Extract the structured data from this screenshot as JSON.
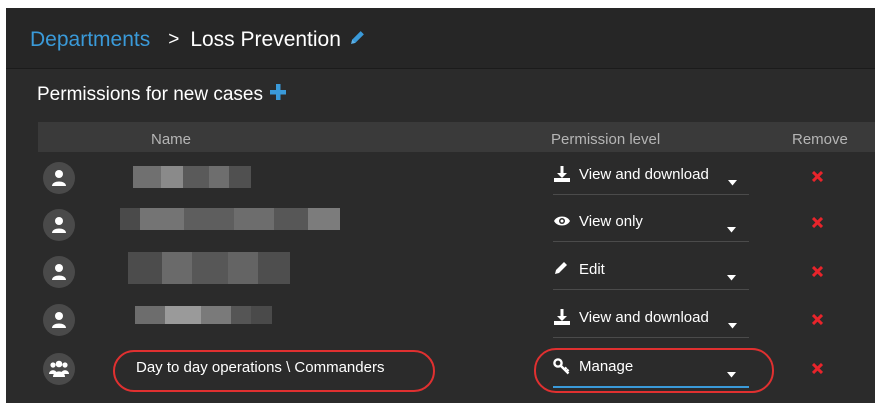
{
  "breadcrumb": {
    "parent": "Departments",
    "separator": ">",
    "current": "Loss Prevention",
    "edit_icon": "pencil-icon"
  },
  "section": {
    "title": "Permissions for new cases",
    "add_icon": "plus-icon"
  },
  "table": {
    "columns": {
      "name": "Name",
      "permission": "Permission level",
      "remove": "Remove"
    },
    "rows": [
      {
        "type": "user",
        "avatar_icon": "user-icon",
        "name": "",
        "permission": "View and download",
        "permission_icon": "download-icon",
        "remove_icon": "close-icon"
      },
      {
        "type": "user",
        "avatar_icon": "user-icon",
        "name": "",
        "permission": "View only",
        "permission_icon": "eye-icon",
        "remove_icon": "close-icon"
      },
      {
        "type": "user",
        "avatar_icon": "user-icon",
        "name": "",
        "permission": "Edit",
        "permission_icon": "pencil-icon",
        "remove_icon": "close-icon"
      },
      {
        "type": "user",
        "avatar_icon": "user-icon",
        "name": "",
        "permission": "View and download",
        "permission_icon": "download-icon",
        "remove_icon": "close-icon"
      },
      {
        "type": "group",
        "avatar_icon": "group-icon",
        "name": "Day to day operations \\ Commanders",
        "permission": "Manage",
        "permission_icon": "key-icon",
        "remove_icon": "close-icon"
      }
    ]
  },
  "colors": {
    "accent": "#3a9ad9",
    "remove": "#e8242b",
    "annotation": "#e03030",
    "panel_bg": "#2b2b2b"
  }
}
